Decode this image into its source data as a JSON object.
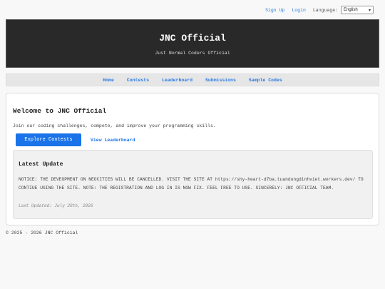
{
  "topbar": {
    "sign_up": "Sign Up",
    "login": "Login",
    "language_label": "Language:",
    "language_selected": "English"
  },
  "header": {
    "title": "JNC Official",
    "subtitle": "Just Normal Coders Official"
  },
  "nav": {
    "items": [
      "Home",
      "Contests",
      "Leaderboard",
      "Submissions",
      "Sample Codes"
    ]
  },
  "welcome": {
    "heading": "Welcome to JNC Official",
    "intro": "Join our coding challenges, compete, and improve your programming skills.",
    "primary_button": "Explore Contests",
    "secondary_link": "View Leaderboard"
  },
  "update": {
    "heading": "Latest Update",
    "notice": "NOTICE: THE DEVEOPMENT ON NEOCITIES WILL BE CANCELLED. VISIT THE SITE AT https://shy-heart-d7ba.tuandungdinhviet.workers.dev/ TO CONTIUE USING THE SITE. NOTE: THE REGISTRATION AND LOG IN IS NOW FIX. FEEL FREE TO USE. SINCERELY: JNC OFFICIAL TEAM.",
    "last_updated": "Last Updated: July 20th, 2026"
  },
  "footer": {
    "copyright": "© 2025 - 2026 JNC Official"
  },
  "colors": {
    "link": "#2a7ae2",
    "primary_button": "#1a73e8",
    "header_bg": "#292929",
    "nav_bg": "#e6e6e6"
  }
}
